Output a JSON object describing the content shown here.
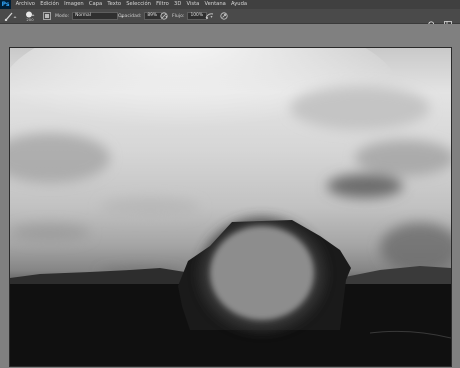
{
  "app": {
    "logo": "Ps"
  },
  "menu": [
    "Archivo",
    "Edición",
    "Imagen",
    "Capa",
    "Texto",
    "Selección",
    "Filtro",
    "3D",
    "Vista",
    "Ventana",
    "Ayuda"
  ],
  "options": {
    "brush_size": "200",
    "mode_label": "Modo:",
    "mode_value": "Normal",
    "opacity_label": "Opacidad:",
    "opacity_value": "89%",
    "flow_label": "Flujo:",
    "flow_value": "100%"
  },
  "icons": [
    "brush-icon",
    "brush-preset-icon",
    "toggle-brush-panel-icon",
    "pressure-opacity-icon",
    "airbrush-icon",
    "pressure-size-icon",
    "search-icon",
    "workspace-icon"
  ]
}
